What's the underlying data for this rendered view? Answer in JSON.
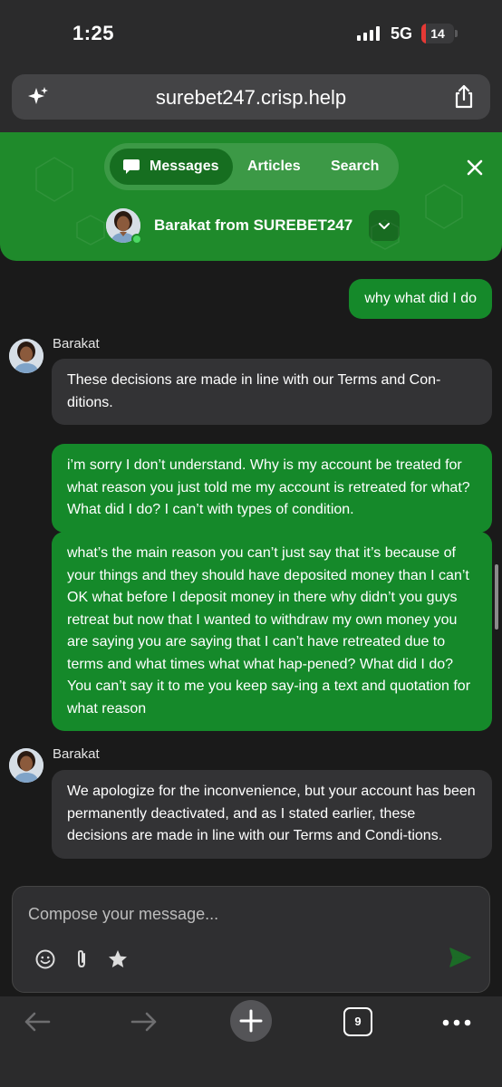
{
  "status_bar": {
    "time": "1:25",
    "network": "5G",
    "battery": "14",
    "battery_level": 0.14,
    "battery_color": "#e53935"
  },
  "browser": {
    "url": "surebet247.crisp.help",
    "left_icon": "sparkle-icon",
    "right_icon": "share-icon"
  },
  "header": {
    "tabs": [
      {
        "label": "Messages",
        "active": true,
        "icon": "chat-bubble-icon"
      },
      {
        "label": "Articles",
        "active": false
      },
      {
        "label": "Search",
        "active": false
      }
    ],
    "close_icon": "close-icon",
    "operator_name": "Barakat from SUREBET247",
    "accent_color": "#1f8a2b"
  },
  "messages": [
    {
      "from": "user",
      "text": "why what did I do"
    },
    {
      "from": "operator",
      "sender": "Barakat",
      "text": "These decisions are made in line with our Terms and Con-ditions."
    },
    {
      "from": "user",
      "text": "i’m sorry I don’t understand. Why is my account be treated for what reason you just told me my account is retreated for what? What did I do? I can’t with types of condition."
    },
    {
      "from": "user",
      "text": "what’s the main reason you can’t just say that it’s because of your things and they should have deposited money than I can’t OK what before I deposit money in there why didn’t you guys retreat but now that I wanted to withdraw my own money you are saying you are saying that I can’t have retreated due to terms and what times what what hap-pened? What did I do? You can’t say it to me you keep say-ing a text and quotation for what reason"
    },
    {
      "from": "operator",
      "sender": "Barakat",
      "text": "We apologize for the inconvenience, but your account has been permanently deactivated, and as I stated earlier, these decisions are made in line with our Terms and Condi-tions."
    }
  ],
  "composer": {
    "placeholder": "Compose your message...",
    "tools": [
      "emoji-icon",
      "attachment-icon",
      "star-icon"
    ],
    "send_icon": "send-icon"
  },
  "bottom_nav": {
    "tabs_count": "9",
    "items": [
      "back-arrow-icon",
      "forward-arrow-icon",
      "new-tab-plus-icon",
      "tabs-icon",
      "more-icon"
    ]
  }
}
